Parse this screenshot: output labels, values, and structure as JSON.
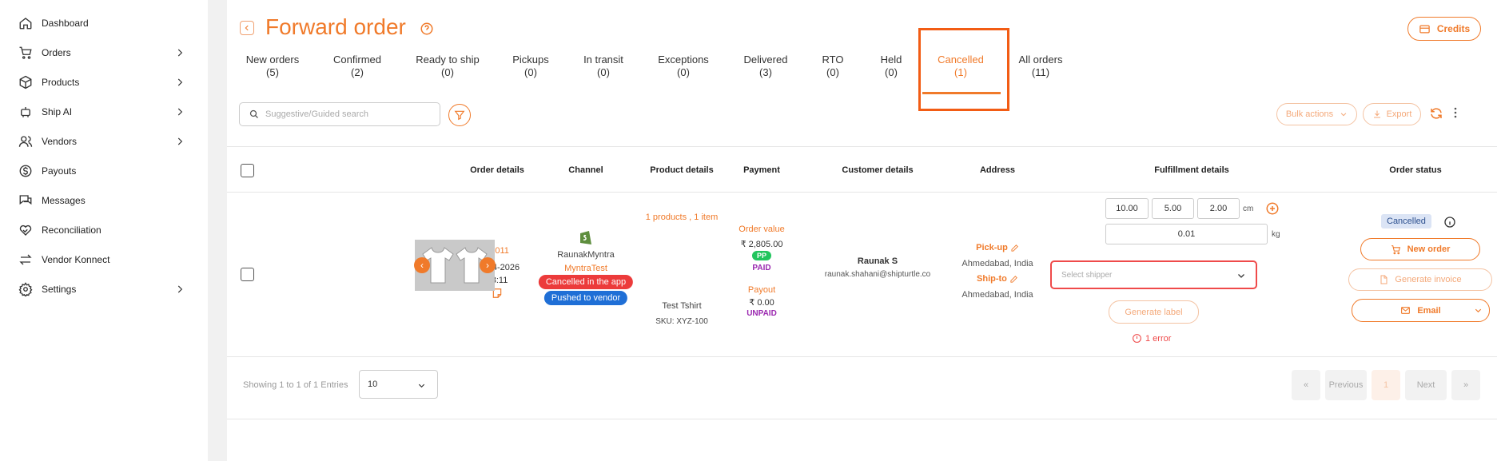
{
  "sidebar": {
    "items": [
      {
        "label": "Dashboard",
        "icon": "home-icon",
        "has_chevron": false
      },
      {
        "label": "Orders",
        "icon": "cart-icon",
        "has_chevron": true
      },
      {
        "label": "Products",
        "icon": "box-icon",
        "has_chevron": true
      },
      {
        "label": "Ship AI",
        "icon": "robot-icon",
        "has_chevron": true
      },
      {
        "label": "Vendors",
        "icon": "users-icon",
        "has_chevron": true
      },
      {
        "label": "Payouts",
        "icon": "dollar-icon",
        "has_chevron": false
      },
      {
        "label": "Messages",
        "icon": "messages-icon",
        "has_chevron": false
      },
      {
        "label": "Reconciliation",
        "icon": "handshake-icon",
        "has_chevron": false
      },
      {
        "label": "Vendor Konnect",
        "icon": "swap-icon",
        "has_chevron": false
      },
      {
        "label": "Settings",
        "icon": "gear-icon",
        "has_chevron": true
      }
    ]
  },
  "header": {
    "title": "Forward order",
    "credits_label": "Credits"
  },
  "tabs": [
    {
      "label": "New orders",
      "count": "(5)"
    },
    {
      "label": "Confirmed",
      "count": "(2)"
    },
    {
      "label": "Ready to ship",
      "count": "(0)"
    },
    {
      "label": "Pickups",
      "count": "(0)"
    },
    {
      "label": "In transit",
      "count": "(0)"
    },
    {
      "label": "Exceptions",
      "count": "(0)"
    },
    {
      "label": "Delivered",
      "count": "(3)"
    },
    {
      "label": "RTO",
      "count": "(0)"
    },
    {
      "label": "Held",
      "count": "(0)"
    },
    {
      "label": "Cancelled",
      "count": "(1)",
      "active": true
    },
    {
      "label": "All orders",
      "count": "(11)"
    }
  ],
  "toolbar": {
    "search_placeholder": "Suggestive/Guided search",
    "bulk_actions_label": "Bulk actions",
    "export_label": "Export"
  },
  "table": {
    "columns": [
      "Order details",
      "Channel",
      "Product details",
      "Payment",
      "Customer details",
      "Address",
      "Fulfillment details",
      "Order status"
    ],
    "row": {
      "order_id": "#1011",
      "order_date": "23-04-2026",
      "order_time": "03:11",
      "channel_store": "RaunakMyntra",
      "channel_name": "MyntraTest",
      "badge_cancelled": "Cancelled in the app",
      "badge_pushed": "Pushed to vendor",
      "product_summary": "1 products , 1 item",
      "product_name": "Test Tshirt",
      "product_sku": "SKU: XYZ-100",
      "order_value_label": "Order value",
      "order_value": "₹ 2,805.00",
      "payment_mode": "PP",
      "payment_status": "PAID",
      "payout_label": "Payout",
      "payout_value": "₹ 0.00",
      "payout_status": "UNPAID",
      "customer_name": "Raunak S",
      "customer_email": "raunak.shahani@shipturtle.co",
      "pickup_label": "Pick-up",
      "pickup_city": "Ahmedabad, India",
      "shipto_label": "Ship-to",
      "shipto_city": "Ahmedabad, India",
      "length": "10.00",
      "width": "5.00",
      "height": "2.00",
      "dim_unit": "cm",
      "weight": "0.01",
      "weight_unit": "kg",
      "shipper_placeholder": "Select shipper",
      "generate_label": "Generate label",
      "error_text": "1 error",
      "status": "Cancelled",
      "new_order_label": "New order",
      "generate_invoice_label": "Generate invoice",
      "email_label": "Email"
    }
  },
  "pagination": {
    "showing_text": "Showing 1 to 1 of 1 Entries",
    "page_size": "10",
    "first": "«",
    "previous": "Previous",
    "current_page": "1",
    "next": "Next",
    "last": "»"
  },
  "colors": {
    "accent": "#f07a2a",
    "highlight_box": "#f25c14",
    "error": "#ef4a4a",
    "paid": "#9b28b0",
    "pp_badge": "#22c55e",
    "cancelled_badge": "#ec3b3b",
    "pushed_badge": "#1f6fd6"
  }
}
